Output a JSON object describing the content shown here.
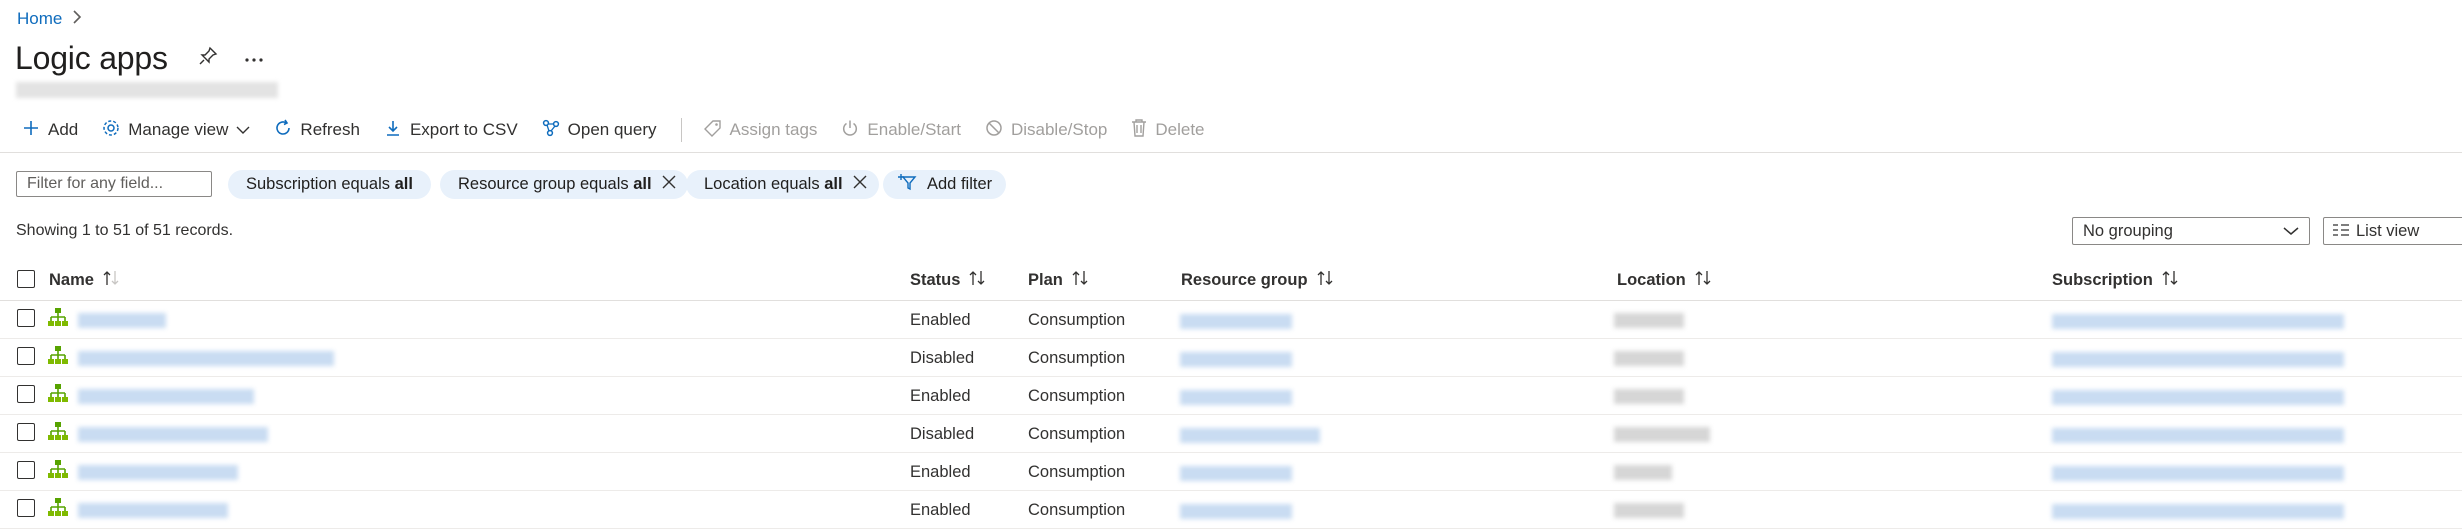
{
  "breadcrumb": {
    "home": "Home",
    "separator": ">"
  },
  "page": {
    "title": "Logic apps"
  },
  "toolbar": {
    "add": "Add",
    "manage_view": "Manage view",
    "refresh": "Refresh",
    "export_csv": "Export to CSV",
    "open_query": "Open query",
    "assign_tags": "Assign tags",
    "enable_start": "Enable/Start",
    "disable_stop": "Disable/Stop",
    "delete": "Delete"
  },
  "filters": {
    "search_placeholder": "Filter for any field...",
    "subscription_prefix": "Subscription equals",
    "subscription_value": "all",
    "resource_group_prefix": "Resource group equals",
    "resource_group_value": "all",
    "location_prefix": "Location equals",
    "location_value": "all",
    "add_filter": "Add filter"
  },
  "records_text": "Showing 1 to 51 of 51 records.",
  "grouping": {
    "selected": "No grouping"
  },
  "view": {
    "selected": "List view"
  },
  "table": {
    "headers": {
      "name": "Name",
      "status": "Status",
      "plan": "Plan",
      "resource_group": "Resource group",
      "location": "Location",
      "subscription": "Subscription"
    },
    "rows": [
      {
        "status": "Enabled",
        "plan": "Consumption"
      },
      {
        "status": "Disabled",
        "plan": "Consumption"
      },
      {
        "status": "Enabled",
        "plan": "Consumption"
      },
      {
        "status": "Disabled",
        "plan": "Consumption"
      },
      {
        "status": "Enabled",
        "plan": "Consumption"
      },
      {
        "status": "Enabled",
        "plan": "Consumption"
      }
    ]
  },
  "colors": {
    "accent": "#0f6cbd",
    "pill_bg": "#e8f1fb",
    "logic_app_icon": "#57a300"
  },
  "icons": {
    "pin": "pin-icon",
    "more": "more-icon",
    "add": "plus-icon",
    "manage_view": "gear-icon",
    "refresh": "refresh-icon",
    "export": "download-icon",
    "open_query": "query-icon",
    "assign_tags": "tag-icon",
    "enable": "power-icon",
    "disable": "block-icon",
    "delete": "trash-icon",
    "logic_app": "logic-app-icon"
  }
}
